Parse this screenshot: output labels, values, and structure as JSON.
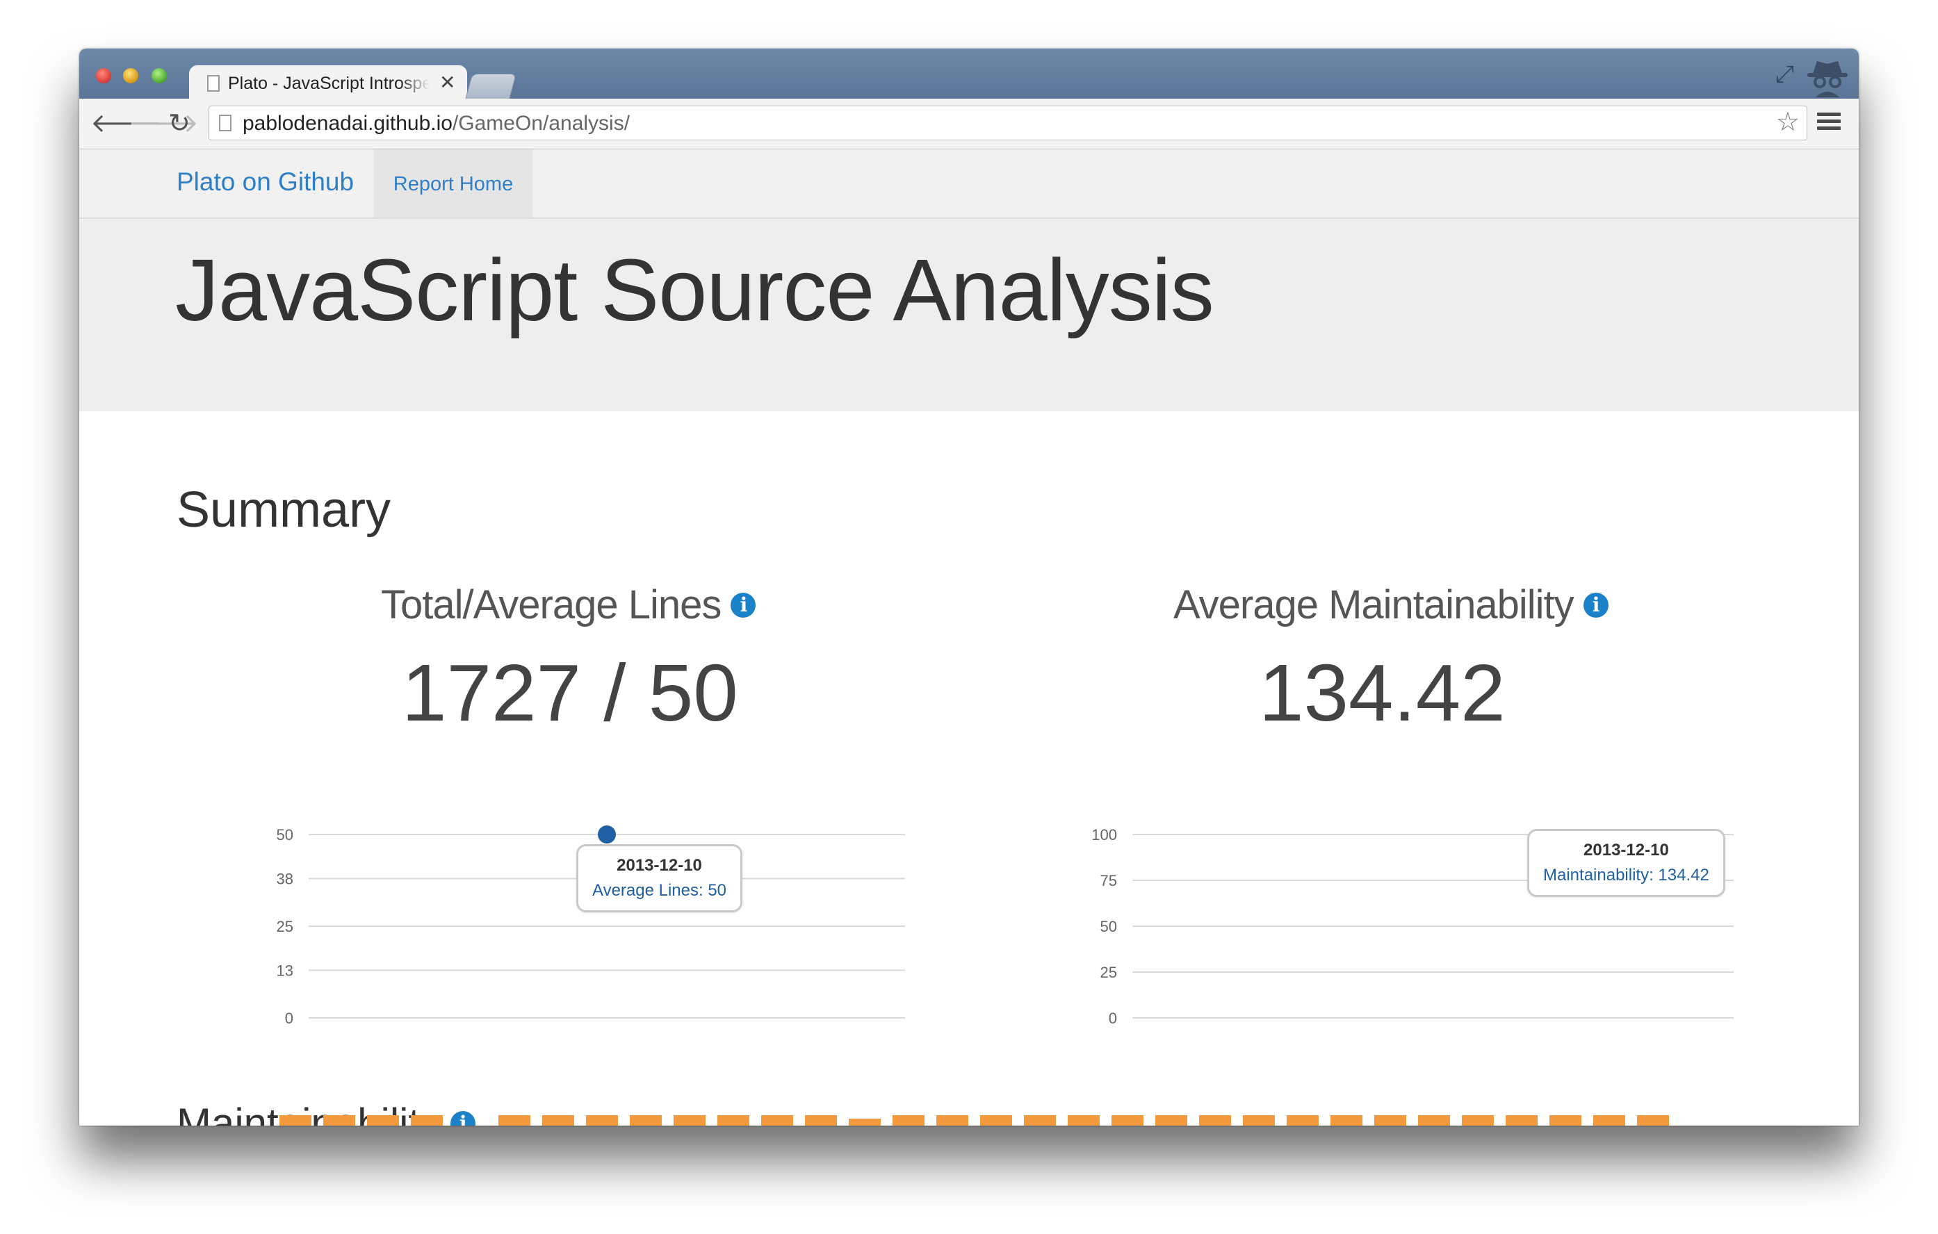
{
  "browser": {
    "tab_title": "Plato - JavaScript Introspection",
    "tab_close": "✕",
    "url_host": "pablodenadai.github.io",
    "url_path": "/GameOn/analysis/",
    "icons": [
      "back-icon",
      "forward-icon",
      "reload-icon",
      "page-icon",
      "star-icon",
      "menu-icon",
      "fullscreen-icon",
      "incognito-icon"
    ]
  },
  "navbar": {
    "brand": "Plato on Github",
    "report_home": "Report Home"
  },
  "header": {
    "title": "JavaScript Source Analysis"
  },
  "summary": {
    "heading": "Summary",
    "lines_label": "Total/Average Lines",
    "lines_value": "1727 / 50",
    "maint_label": "Average Maintainability",
    "maint_value": "134.42",
    "info_glyph": "i"
  },
  "chart_data": [
    {
      "type": "line",
      "title": "",
      "x": [
        "2013-12-10"
      ],
      "series": [
        {
          "name": "Average Lines",
          "values": [
            50
          ]
        }
      ],
      "yticks": [
        0,
        13,
        25,
        38,
        50
      ],
      "ylim": [
        0,
        50
      ],
      "grid": true,
      "point_color": "#1f5fa3",
      "tooltip": {
        "date": "2013-12-10",
        "text": "Average Lines: 50"
      }
    },
    {
      "type": "line",
      "title": "",
      "x": [
        "2013-12-10"
      ],
      "series": [
        {
          "name": "Maintainability",
          "values": [
            134.42
          ]
        }
      ],
      "yticks": [
        0,
        25,
        50,
        75,
        100
      ],
      "ylim": [
        0,
        100
      ],
      "grid": true,
      "tooltip": {
        "date": "2013-12-10",
        "text": "Maintainability: 134.42"
      }
    }
  ],
  "maintainability": {
    "heading": "Maintainability",
    "bar_color": "#f39a3f"
  }
}
